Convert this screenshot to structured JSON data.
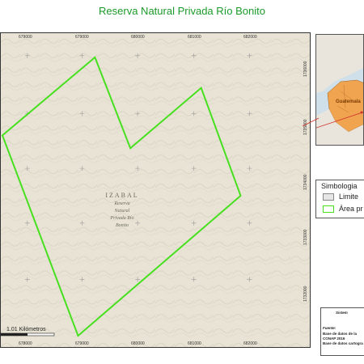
{
  "title": "Reserva Natural Privada Río Bonito",
  "map": {
    "region_label": "IZABAL",
    "reserve_label_lines": [
      "Reserva",
      "Natural",
      "Privada Río",
      "Bonito"
    ],
    "boundary_color": "#46e01e",
    "x_ticks_top": [
      "679000",
      "679000",
      "680000",
      "681000",
      "682000"
    ],
    "x_ticks_bottom": [
      "678000",
      "679000",
      "680000",
      "681000",
      "682000"
    ],
    "y_ticks_right": [
      "1736000",
      "1735000",
      "1734000",
      "1733000",
      "1732000"
    ],
    "scale_label": "1.01 Kilómetros"
  },
  "inset": {
    "label": "Guatemala"
  },
  "legend": {
    "title": "Simbologia",
    "items": [
      {
        "label": "Limite",
        "fill": "#e6e6e6",
        "stroke": "#888888"
      },
      {
        "label": "Área pr",
        "fill": "#ffffff",
        "stroke": "#46e01e"
      }
    ]
  },
  "info": {
    "heading": "Sistem",
    "source_label": "Fuente:",
    "lines": [
      "Base de datos de la",
      "CONAP 2016",
      "Base de datos cartogra"
    ]
  }
}
